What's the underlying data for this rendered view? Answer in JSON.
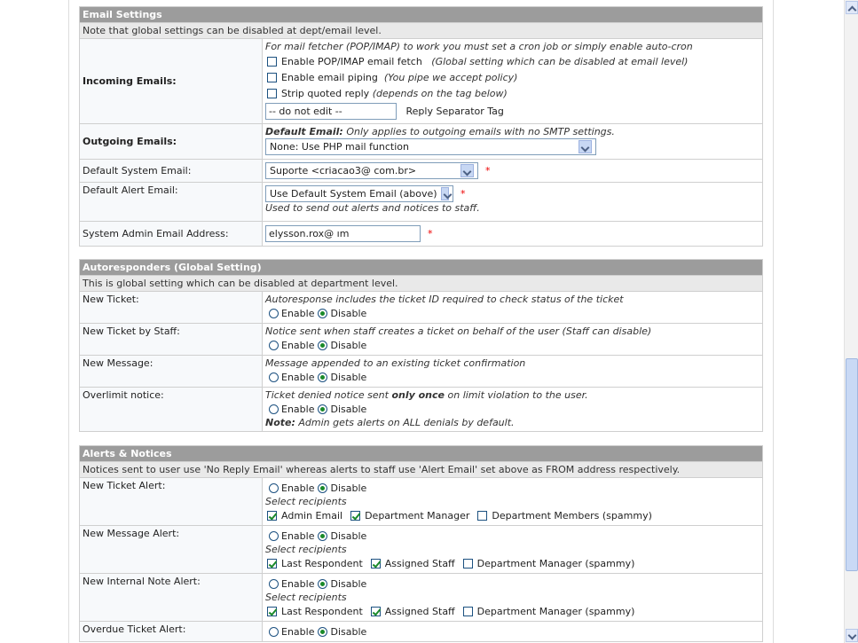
{
  "email_settings": {
    "header": "Email Settings",
    "note": "Note that global settings can be disabled at dept/email level.",
    "incoming": {
      "label": "Incoming Emails:",
      "hint": "For mail fetcher (POP/IMAP) to work you must set a cron job or simply enable auto-cron",
      "opt1_label": "Enable POP/IMAP email fetch",
      "opt1_hint": "(Global setting which can be disabled at email level)",
      "opt2_label": "Enable email piping",
      "opt2_hint": "(You pipe we accept policy)",
      "opt3_label": "Strip quoted reply",
      "opt3_hint": "(depends on the tag below)",
      "separator_value": "-- do not edit --",
      "separator_label": "Reply Separator Tag"
    },
    "outgoing": {
      "label": "Outgoing Emails:",
      "hint_bold": "Default Email:",
      "hint": " Only applies to outgoing emails with no SMTP settings.",
      "select_value": "None: Use PHP mail function"
    },
    "default_system": {
      "label": "Default System Email:",
      "value": "Suporte <criacao3@                com.br>",
      "required": "*"
    },
    "default_alert": {
      "label": "Default Alert Email:",
      "value": "Use Default System Email (above)",
      "required": "*",
      "hint": "Used to send out alerts and notices to staff."
    },
    "admin_email": {
      "label": "System Admin Email Address:",
      "value": "elysson.rox@              ım",
      "required": "*"
    }
  },
  "autoresponders": {
    "header": "Autoresponders  (Global Setting)",
    "note": "This is global setting which can be disabled at department level.",
    "enable": "Enable",
    "disable": "Disable",
    "new_ticket": {
      "label": "New Ticket:",
      "hint": "Autoresponse includes the ticket ID required to check status of the ticket"
    },
    "new_ticket_staff": {
      "label": "New Ticket by Staff:",
      "hint": "Notice sent when staff creates a ticket on behalf of the user (Staff can disable)"
    },
    "new_message": {
      "label": "New Message:",
      "hint": "Message appended to an existing ticket confirmation"
    },
    "overlimit": {
      "label": "Overlimit notice:",
      "hint_a": "Ticket denied notice sent ",
      "hint_b": "only once",
      "hint_c": " on limit violation to the user.",
      "note_bold": "Note:",
      "note": " Admin gets alerts on ALL denials by default."
    }
  },
  "alerts": {
    "header": "Alerts & Notices",
    "note": "Notices sent to user use 'No Reply Email' whereas alerts to staff use 'Alert Email' set above as FROM address respectively.",
    "enable": "Enable",
    "disable": "Disable",
    "select_recipients": "Select recipients",
    "new_ticket_alert": {
      "label": "New Ticket Alert:",
      "r1": "Admin Email",
      "r2": "Department Manager",
      "r3": "Department Members (spammy)"
    },
    "new_message_alert": {
      "label": "New Message Alert:",
      "r1": "Last Respondent",
      "r2": "Assigned Staff",
      "r3": "Department Manager (spammy)"
    },
    "internal_note_alert": {
      "label": "New Internal Note Alert:",
      "r1": "Last Respondent",
      "r2": "Assigned Staff",
      "r3": "Department Manager (spammy)"
    },
    "overdue_alert": {
      "label": "Overdue Ticket Alert:"
    }
  }
}
